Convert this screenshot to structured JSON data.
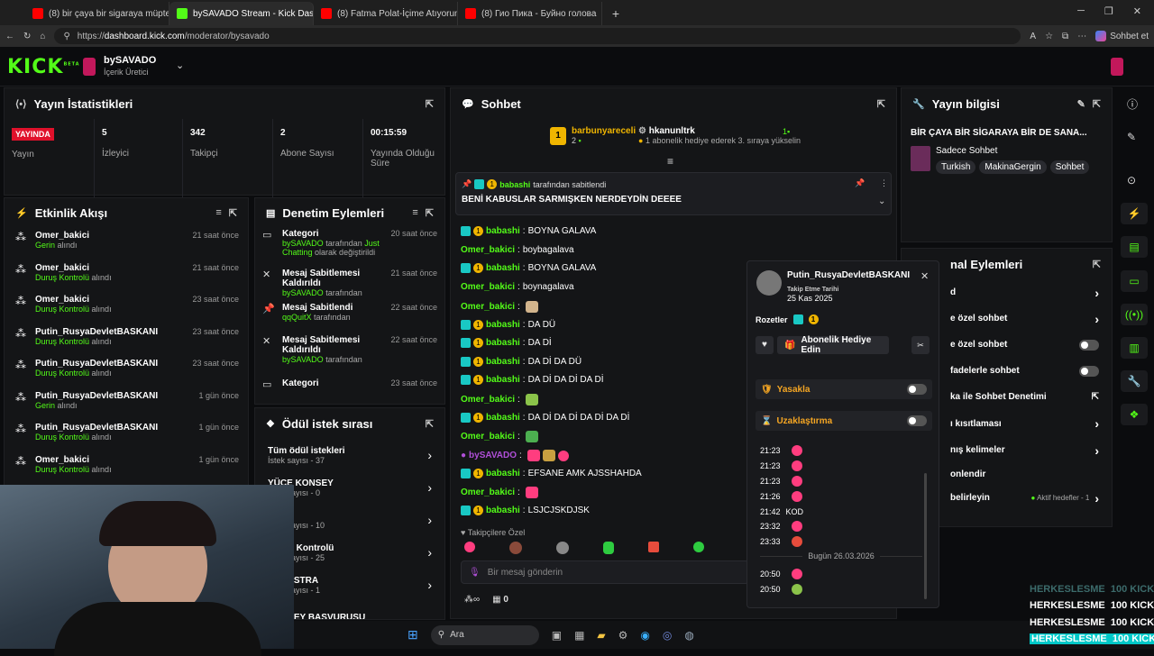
{
  "browser": {
    "tabs": [
      {
        "title": "(8) bir çaya bir sigaraya müptelayız",
        "icon_color": "#ff0000"
      },
      {
        "title": "bySAVADO Stream - Kick Dashboard",
        "icon_color": "#53fc18"
      },
      {
        "title": "(8) Fatma Polat-İçime Atıyorum aşkı",
        "icon_color": "#ff0000"
      },
      {
        "title": "(8) Гио Пика - Буйно голова",
        "icon_color": "#ff0000"
      }
    ],
    "url_prefix": "https://",
    "url_domain": "dashboard.kick.com",
    "url_path": "/moderator/bysavado",
    "copilot_label": "Sohbet et"
  },
  "header": {
    "logo": "KICK",
    "logo_tag": "BETA",
    "channel": "bySAVADO",
    "role": "İçerik Üretici"
  },
  "stats": {
    "title": "Yayın İstatistikleri",
    "live_badge": "YAYINDA",
    "live_label": "Yayın",
    "viewers": "5",
    "viewers_label": "İzleyici",
    "followers": "342",
    "followers_label": "Takipçi",
    "subs": "2",
    "subs_label": "Abone Sayısı",
    "uptime": "00:15:59",
    "uptime_label": "Yayında Olduğu Süre"
  },
  "activity": {
    "title": "Etkinlik Akışı",
    "items": [
      {
        "user": "Omer_bakici",
        "action": "Gerin",
        "suffix": "alındı",
        "time": "21 saat önce"
      },
      {
        "user": "Omer_bakici",
        "action": "Duruş Kontrolü",
        "suffix": "alındı",
        "time": "21 saat önce"
      },
      {
        "user": "Omer_bakici",
        "action": "Duruş Kontrolü",
        "suffix": "alındı",
        "time": "23 saat önce"
      },
      {
        "user": "Putin_RusyaDevletBASKANI",
        "action": "Duruş Kontrolü",
        "suffix": "alındı",
        "time": "23 saat önce"
      },
      {
        "user": "Putin_RusyaDevletBASKANI",
        "action": "Duruş Kontrolü",
        "suffix": "alındı",
        "time": "23 saat önce"
      },
      {
        "user": "Putin_RusyaDevletBASKANI",
        "action": "Gerin",
        "suffix": "alındı",
        "time": "1 gün önce"
      },
      {
        "user": "Putin_RusyaDevletBASKANI",
        "action": "Duruş Kontrolü",
        "suffix": "alındı",
        "time": "1 gün önce"
      },
      {
        "user": "Omer_bakici",
        "action": "Duruş Kontrolü",
        "suffix": "alındı",
        "time": "1 gün önce"
      }
    ]
  },
  "moderation": {
    "title": "Denetim Eylemleri",
    "items": [
      {
        "title": "Kategori",
        "user": "bySAVADO",
        "mid": "tarafından",
        "hl": "Just Chatting",
        "tail": "olarak değiştirildi",
        "time": "20 saat önce"
      },
      {
        "title": "Mesaj Sabitlemesi Kaldırıldı",
        "user": "bySAVADO",
        "mid": "tarafından",
        "hl": "",
        "tail": "",
        "time": "21 saat önce"
      },
      {
        "title": "Mesaj Sabitlendi",
        "user": "qqQuitX",
        "mid": "tarafından",
        "hl": "",
        "tail": "",
        "time": "22 saat önce"
      },
      {
        "title": "Mesaj Sabitlemesi Kaldırıldı",
        "user": "bySAVADO",
        "mid": "tarafından",
        "hl": "",
        "tail": "",
        "time": "22 saat önce"
      },
      {
        "title": "Kategori",
        "user": "",
        "mid": "",
        "hl": "",
        "tail": "",
        "time": "23 saat önce"
      }
    ]
  },
  "rewards": {
    "title": "Ödül istek sırası",
    "items": [
      {
        "label": "Tüm ödül istekleri",
        "count": "İstek sayısı - 37"
      },
      {
        "label": "YÜCE KONSEY",
        "count": "İstek sayısı - 0"
      },
      {
        "label": "Gerin",
        "count": "İstek sayısı - 10"
      },
      {
        "label": "Duruş Kontrolü",
        "count": "İstek sayısı - 25"
      },
      {
        "label": "ORKESTRA",
        "count": "İstek sayısı - 1"
      },
      {
        "label": "KONSEY BASVURUSU",
        "count": ""
      }
    ]
  },
  "chat": {
    "title": "Sohbet",
    "top_gifter": "barbunyareceli",
    "top_gifter_count": "2",
    "gifter2": "hkanunltrk",
    "gifter2_count": "1",
    "gift_note": "1 abonelik hediye ederek 3. sıraya yükselin",
    "pinned_by": "babashi",
    "pinned_suffix": "tarafından sabitlendi",
    "pinned_msg": "BENİ KABUSLAR SARMIŞKEN NERDEYDİN DEEEE",
    "lines": [
      {
        "user": "babashi",
        "msg": "BOYNA GALAVA",
        "badges": true
      },
      {
        "user": "Omer_bakici",
        "msg": "boybagalava",
        "badges": false
      },
      {
        "user": "babashi",
        "msg": "BOYNA GALAVA",
        "badges": true
      },
      {
        "user": "Omer_bakici",
        "msg": "boynagalava",
        "badges": false
      },
      {
        "user": "Omer_bakici",
        "msg": "",
        "badges": false
      },
      {
        "user": "babashi",
        "msg": "DA DÜ",
        "badges": true
      },
      {
        "user": "babashi",
        "msg": "DA Dİ",
        "badges": true
      },
      {
        "user": "babashi",
        "msg": "DA Dİ DA DÜ",
        "badges": true
      },
      {
        "user": "babashi",
        "msg": "DA Dİ DA Dİ DA Dİ",
        "badges": true
      },
      {
        "user": "Omer_bakici",
        "msg": "",
        "badges": false
      },
      {
        "user": "babashi",
        "msg": "DA Dİ DA Dİ DA Dİ DA Dİ",
        "badges": true
      },
      {
        "user": "Omer_bakici",
        "msg": "",
        "badges": false
      },
      {
        "user": "bySAVADO",
        "msg": "",
        "badges": false
      },
      {
        "user": "babashi",
        "msg": "EFSANE AMK AJSSHAHDA",
        "badges": true
      },
      {
        "user": "Omer_bakici",
        "msg": "",
        "badges": false
      },
      {
        "user": "babashi",
        "msg": "LSJCJSKDJSK",
        "badges": true
      }
    ],
    "emote_label": "Takipçilere Özel",
    "input_placeholder": "Bir mesaj gönderin",
    "footer_count": "0"
  },
  "streaminfo": {
    "title": "Yayın bilgisi",
    "stream_title": "BİR ÇAYA BİR SİGARAYA BİR DE SANA...",
    "category": "Sadece Sohbet",
    "tags": [
      "Turkish",
      "MakinaGergin",
      "Sohbet"
    ]
  },
  "channel_actions": {
    "title": "nal Eylemleri",
    "items": [
      {
        "label": "d",
        "type": "arrow"
      },
      {
        "label": "e özel sohbet",
        "type": "arrow"
      },
      {
        "label": "e özel sohbet",
        "type": "toggle"
      },
      {
        "label": "fadelerle sohbet",
        "type": "toggle"
      },
      {
        "label": "ka ile Sohbet Denetimi",
        "type": "link"
      },
      {
        "label": "ı kısıtlaması",
        "type": "arrow"
      },
      {
        "label": "nış kelimeler",
        "type": "arrow"
      },
      {
        "label": "onlendir",
        "type": "none"
      },
      {
        "label": "belirleyin",
        "type": "goal"
      }
    ],
    "goal_label": "Aktif hedefler - 1"
  },
  "user_card": {
    "username": "Putin_RusyaDevletBASKANI",
    "follow_label": "Takip Etme Tarihi",
    "follow_date": "25 Kas 2025",
    "badges_label": "Rozetler",
    "gift_button": "Abonelik Hediye Edin",
    "ban_label": "Yasakla",
    "timeout_label": "Uzaklaştırma",
    "history": [
      {
        "time": "21:23",
        "msg": ""
      },
      {
        "time": "21:23",
        "msg": ""
      },
      {
        "time": "21:23",
        "msg": ""
      },
      {
        "time": "21:26",
        "msg": ""
      },
      {
        "time": "21:42",
        "msg": "KOD"
      },
      {
        "time": "23:32",
        "msg": ""
      },
      {
        "time": "23:33",
        "msg": ""
      }
    ],
    "divider": "Bugün 26.03.2026",
    "history2": [
      {
        "time": "20:50",
        "msg": ""
      },
      {
        "time": "20:50",
        "msg": ""
      }
    ]
  },
  "taskbar": {
    "search": "Ara"
  },
  "overlay": {
    "kicks": [
      "HERKESLESME  100 KICKS",
      "HERKESLESME  100 KICKS",
      "HERKESLESME  100 KICKS",
      "HERKESLESME  100 KICKS"
    ]
  }
}
